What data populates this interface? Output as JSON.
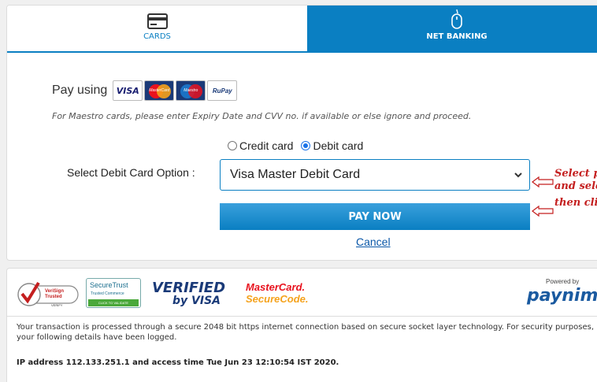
{
  "tabs": {
    "cards": "CARDS",
    "net_banking": "NET BANKING"
  },
  "pay_using": {
    "label": "Pay using",
    "logos": [
      "VISA",
      "MasterCard",
      "Maestro",
      "RuPay"
    ]
  },
  "note": "For Maestro cards, please enter Expiry Date and CVV no. if available or else ignore and proceed.",
  "card_type": {
    "options": [
      "Credit card",
      "Debit card"
    ],
    "selected": "Debit card"
  },
  "debit_option": {
    "label": "Select Debit Card Option :",
    "selected_value": "Visa Master Debit Card"
  },
  "pay_now": "PAY NOW",
  "cancel": "Cancel",
  "annotation": [
    "Select p",
    "and sele",
    "then cli"
  ],
  "security_logos": {
    "verisign": [
      "VeriSign",
      "Trusted",
      "VERIFY"
    ],
    "securetrust": [
      "SecureTrust",
      "Trusted Commerce",
      "CLICK TO VALIDATE"
    ],
    "verified_visa": [
      "VERIFIED",
      "by VISA"
    ],
    "mastercard": [
      "MasterCard.",
      "SecureCode."
    ]
  },
  "powered_by": "Powered by",
  "brand": "paynimo",
  "info_text": "Your transaction is processed through a secure 2048 bit https internet connection based on secure socket layer technology. For security purposes, your following details have been logged.",
  "ip_text": "IP address 112.133.251.1 and access time Tue Jun 23 12:10:54 IST 2020.",
  "colors": {
    "primary": "#0a7fc2",
    "annotation": "#c41f1f"
  }
}
